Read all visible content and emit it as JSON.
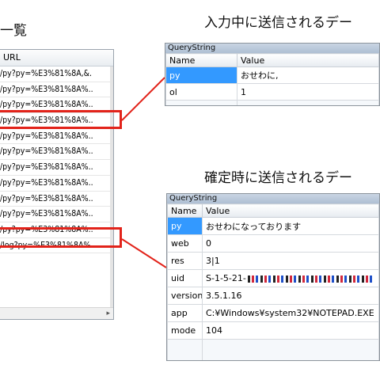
{
  "headings": {
    "list": "一覧",
    "typing": "入力中に送信されるデー",
    "confirm": "確定時に送信されるデー"
  },
  "url_list": {
    "header": "URL",
    "rows": [
      "/py?py=%E3%81%8A,&.",
      "/py?py=%E3%81%8A%..",
      "/py?py=%E3%81%8A%..",
      "/py?py=%E3%81%8A%..",
      "/py?py=%E3%81%8A%..",
      "/py?py=%E3%81%8A%..",
      "/py?py=%E3%81%8A%..",
      "/py?py=%E3%81%8A%..",
      "/py?py=%E3%81%8A%..",
      "/py?py=%E3%81%8A%..",
      "/py?py=%E3%81%8A%..",
      "/log?py=%E3%81%8A%."
    ]
  },
  "query_typing": {
    "title": "QueryString",
    "col_name": "Name",
    "col_value": "Value",
    "rows": [
      {
        "name": "py",
        "value": "おせわに,"
      },
      {
        "name": "ol",
        "value": "1"
      }
    ]
  },
  "query_confirm": {
    "title": "QueryString",
    "col_name": "Name",
    "col_value": "Value",
    "rows": [
      {
        "name": "py",
        "value": "おせわになっております"
      },
      {
        "name": "web",
        "value": "0"
      },
      {
        "name": "res",
        "value": "3|1"
      },
      {
        "name": "uid",
        "value": "S-1-5-21-"
      },
      {
        "name": "version",
        "value": "3.5.1.16"
      },
      {
        "name": "app",
        "value": "C:¥Windows¥system32¥NOTEPAD.EXE"
      },
      {
        "name": "mode",
        "value": "104"
      }
    ]
  },
  "colors": {
    "highlight": "#e2231a",
    "selection": "#3399ff"
  }
}
